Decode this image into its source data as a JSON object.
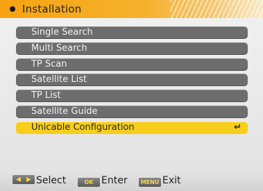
{
  "header": {
    "title": "Installation"
  },
  "menu": {
    "items": [
      {
        "label": "Single Search"
      },
      {
        "label": "Multi Search"
      },
      {
        "label": "TP Scan"
      },
      {
        "label": "Satellite List"
      },
      {
        "label": "TP List"
      },
      {
        "label": "Satellite Guide"
      },
      {
        "label": "Unicable Configuration",
        "selected": true,
        "icon": "enter-icon"
      }
    ]
  },
  "footer": {
    "select": {
      "key": "",
      "label": "Select"
    },
    "enter": {
      "key": "OK",
      "label": "Enter"
    },
    "exit": {
      "key": "MENU",
      "label": "Exit"
    }
  },
  "colors": {
    "title_bar": "#f7a312",
    "item_bg": "#6d6d6d",
    "item_selected": "#f7ce1b"
  }
}
